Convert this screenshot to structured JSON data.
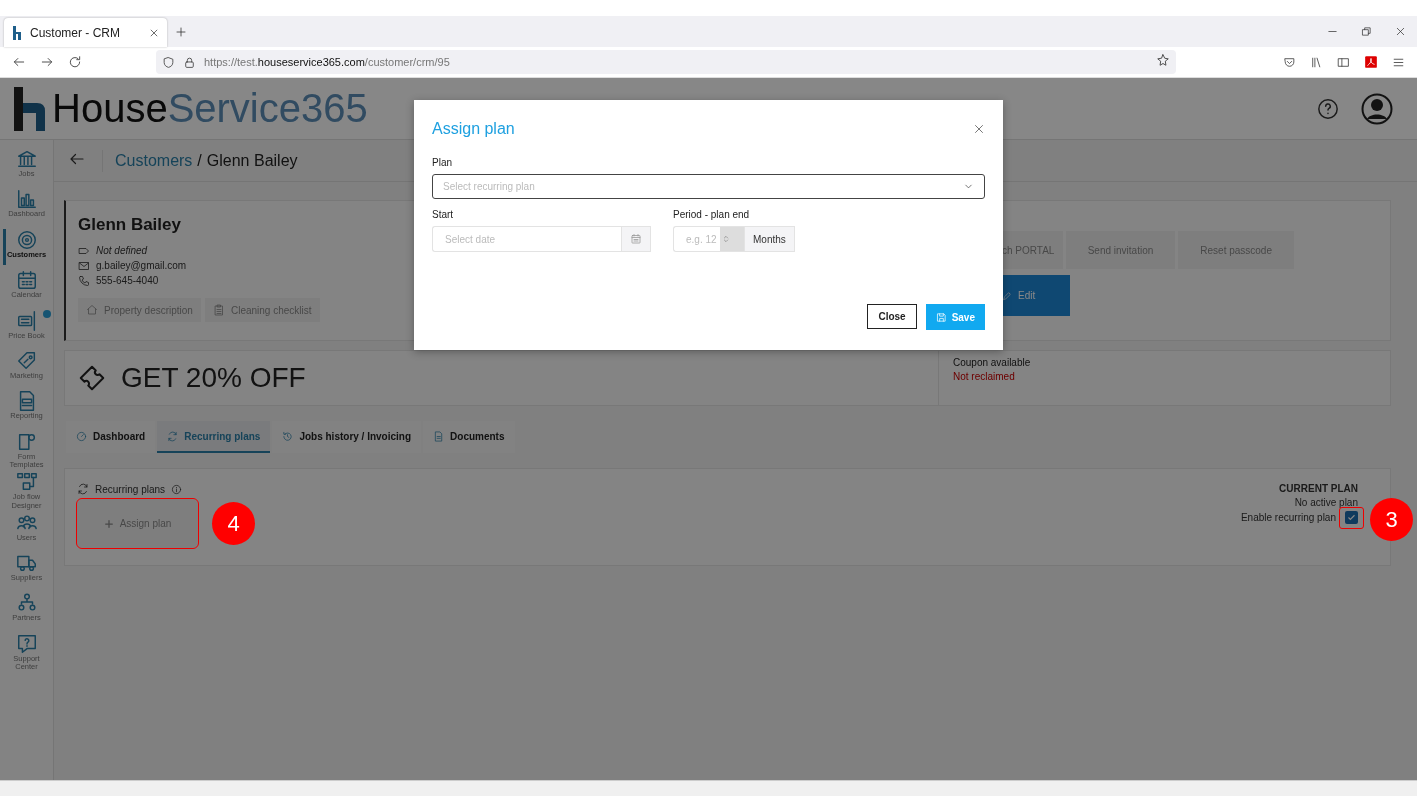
{
  "browser": {
    "tab_title": "Customer - CRM",
    "url": "https://test.**houseservice365.com**/customer/crm/95"
  },
  "header": {
    "logo": "House**Service365**"
  },
  "sidebar": {
    "items": [
      {
        "label": "Jobs",
        "selected": false
      },
      {
        "label": "Dashboard",
        "selected": false
      },
      {
        "label": "Customers",
        "selected": true
      },
      {
        "label": "Calendar",
        "selected": false
      },
      {
        "label": "Price Book",
        "selected": false
      },
      {
        "label": "Marketing",
        "selected": false
      },
      {
        "label": "Reporting",
        "selected": false
      },
      {
        "label": "Form Templates",
        "selected": false
      },
      {
        "label": "Job flow Designer",
        "selected": false
      },
      {
        "label": "Users",
        "selected": false
      },
      {
        "label": "Suppliers",
        "selected": false
      },
      {
        "label": "Partners",
        "selected": false
      },
      {
        "label": "Support Center",
        "selected": false
      }
    ]
  },
  "breadcrumb": {
    "parent": "Customers",
    "separator": "/",
    "current": "Glenn Bailey"
  },
  "customer": {
    "name": "Glenn Bailey",
    "details": [
      {
        "kind": "type",
        "text": "Not defined"
      },
      {
        "kind": "email",
        "text": "g.bailey@gmail.com"
      },
      {
        "kind": "phone",
        "text": "555-645-4040"
      }
    ],
    "buttons": [
      {
        "kind": "property",
        "label": "Property description"
      },
      {
        "kind": "checklist",
        "label": "Cleaning checklist"
      }
    ],
    "portal_actions": [
      "ch PORTAL",
      "Send invitation",
      "Reset passcode"
    ],
    "edit_button": "Edit"
  },
  "coupon": {
    "headline": "GET 20% OFF",
    "label": "Coupon available",
    "status": "Not reclaimed"
  },
  "tabs": [
    {
      "kind": "dashboard",
      "label": "Dashboard",
      "selected": false
    },
    {
      "kind": "recurring",
      "label": "Recurring plans",
      "selected": true
    },
    {
      "kind": "history",
      "label": "Jobs history / Invoicing",
      "selected": false
    },
    {
      "kind": "documents",
      "label": "Documents",
      "selected": false
    }
  ],
  "recurring": {
    "title": "Recurring plans",
    "assign_button": "Assign plan",
    "assign_marker": "4",
    "heading": "CURRENT PLAN",
    "plan": "No active plan",
    "enable_label": "Enable recurring plan",
    "enabled": true,
    "enable_marker": "3"
  },
  "modal": {
    "title": "Assign plan",
    "plan_label": "Plan",
    "plan_placeholder": "Select recurring plan",
    "start_label": "Start",
    "start_placeholder": "Select date",
    "period_label": "Period - plan end",
    "period_placeholder": "e.g. 12",
    "period_unit": "Months",
    "buttons": [
      {
        "kind": "secondary",
        "label": "Close"
      },
      {
        "kind": "primary",
        "label": "Save"
      }
    ]
  }
}
